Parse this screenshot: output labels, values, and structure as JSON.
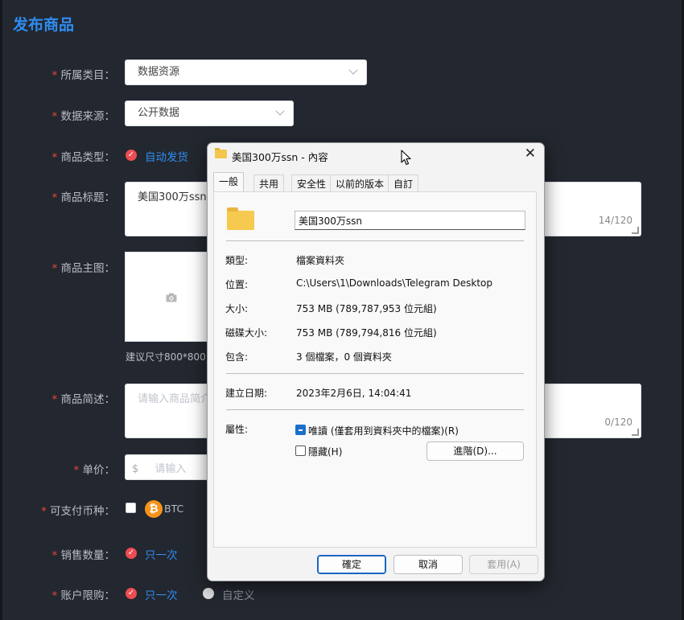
{
  "page": {
    "title": "发布商品",
    "required_mark": "*",
    "category": {
      "label": "所属类目：",
      "value": "数据资源"
    },
    "source": {
      "label": "数据来源：",
      "value": "公开数据"
    },
    "type": {
      "label": "商品类型：",
      "option": "自动发货"
    },
    "title_field": {
      "label": "商品标题：",
      "value": "美国300万ssn",
      "counter": "14/120"
    },
    "main_image": {
      "label": "商品主图：",
      "hint": "建议尺寸800*800，"
    },
    "description": {
      "label": "商品简述：",
      "placeholder": "请输入商品简介",
      "counter": "0/120"
    },
    "price": {
      "label": "单价：",
      "currency": "$",
      "placeholder": "请输入"
    },
    "coins": {
      "label": "可支付币种：",
      "btc": "BTC"
    },
    "sale_qty": {
      "label": "销售数量：",
      "option": "只一次"
    },
    "account_limit": {
      "label": "账户限购：",
      "option1": "只一次",
      "option2": "自定义"
    }
  },
  "dialog": {
    "title": "美国300万ssn - 內容",
    "tabs": [
      "一般",
      "共用",
      "安全性",
      "以前的版本",
      "自訂"
    ],
    "active_tab": "一般",
    "name": "美国300万ssn",
    "props": [
      {
        "key": "類型:",
        "value": "檔案資料夾"
      },
      {
        "key": "位置:",
        "value": "C:\\Users\\1\\Downloads\\Telegram Desktop"
      },
      {
        "key": "大小:",
        "value": "753 MB (789,787,953 位元組)"
      },
      {
        "key": "磁碟大小:",
        "value": "753 MB (789,794,816 位元組)"
      },
      {
        "key": "包含:",
        "value": "3 個檔案，0 個資料夾"
      }
    ],
    "created": {
      "key": "建立日期:",
      "value": "2023年2月6日, 14:04:41"
    },
    "attributes": {
      "key": "屬性:",
      "readonly": "唯讀 (僅套用到資料夾中的檔案)(R)",
      "hidden": "隱藏(H)",
      "advanced": "進階(D)..."
    },
    "buttons": {
      "ok": "確定",
      "cancel": "取消",
      "apply": "套用(A)"
    }
  },
  "colors": {
    "accent": "#2f8cf0",
    "required": "#e8473f",
    "radio": "#ed4c52",
    "btc": "#f7931a"
  }
}
